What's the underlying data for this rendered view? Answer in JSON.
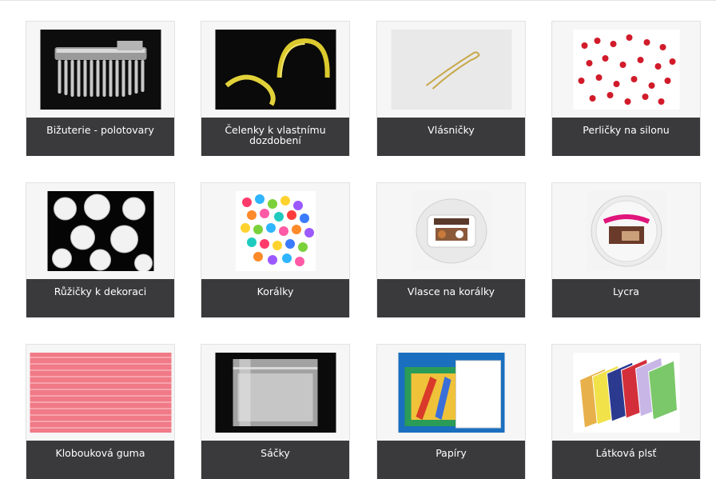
{
  "categories": [
    {
      "label": "Bižuterie - polotovary",
      "icon": "hair-comb-icon"
    },
    {
      "label": "Čelenky k vlastnímu dozdobení",
      "icon": "headband-icon"
    },
    {
      "label": "Vlásničky",
      "icon": "hairpin-icon"
    },
    {
      "label": "Perličky na silonu",
      "icon": "pearl-strand-icon"
    },
    {
      "label": "Růžičky k dekoraci",
      "icon": "rose-icon"
    },
    {
      "label": "Korálky",
      "icon": "beads-icon"
    },
    {
      "label": "Vlasce na korálky",
      "icon": "fishing-line-spool-icon"
    },
    {
      "label": "Lycra",
      "icon": "elastic-spool-icon"
    },
    {
      "label": "Klobouková guma",
      "icon": "elastic-cord-icon"
    },
    {
      "label": "Sáčky",
      "icon": "zip-bag-icon"
    },
    {
      "label": "Papíry",
      "icon": "paper-pack-icon"
    },
    {
      "label": "Látková plsť",
      "icon": "felt-sheets-icon"
    }
  ],
  "colors": {
    "caption_bg": "#3a3a3c",
    "card_bg": "#f6f6f6",
    "caption_text": "#ffffff"
  }
}
